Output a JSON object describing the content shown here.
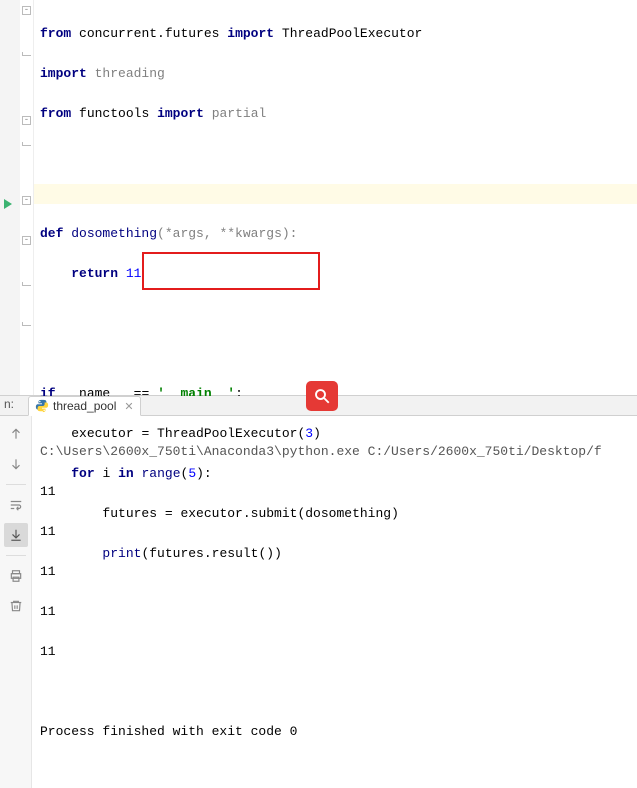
{
  "code": {
    "l1": {
      "kw1": "from",
      "mod1": "concurrent.futures",
      "kw2": "import",
      "name": "ThreadPoolExecutor"
    },
    "l2": {
      "kw": "import",
      "mod": "threading"
    },
    "l3": {
      "kw1": "from",
      "mod": "functools",
      "kw2": "import",
      "name": "partial"
    },
    "l6": {
      "kw": "def",
      "fn": "dosomething",
      "params": "(*args, **kwargs):"
    },
    "l7": {
      "kw": "return",
      "val": "11"
    },
    "l10": {
      "kw": "if",
      "name": "__name__",
      "op": " == ",
      "str": "'__main__'",
      "colon": ":"
    },
    "l11": {
      "var": "executor",
      "op": " = ",
      "cls": "ThreadPoolExecutor",
      "args": "(",
      "num": "3",
      "close": ")"
    },
    "l12": {
      "kw1": "for",
      "var": "i",
      "kw2": "in",
      "fn": "range",
      "args": "(",
      "num": "5",
      "close": "):"
    },
    "l13": {
      "var": "futures",
      "op": " = ",
      "expr": "executor.submit(dosomething)"
    },
    "l14": {
      "fn": "print",
      "open": "(",
      "expr": "futures.result()",
      "close": ")"
    }
  },
  "tab": {
    "label": "thread_pool",
    "prefix": "n:"
  },
  "console": {
    "cmd": "C:\\Users\\2600x_750ti\\Anaconda3\\python.exe C:/Users/2600x_750ti/Desktop/f",
    "outputs": [
      "11",
      "11",
      "11",
      "11",
      "11"
    ],
    "exit": "Process finished with exit code 0"
  }
}
